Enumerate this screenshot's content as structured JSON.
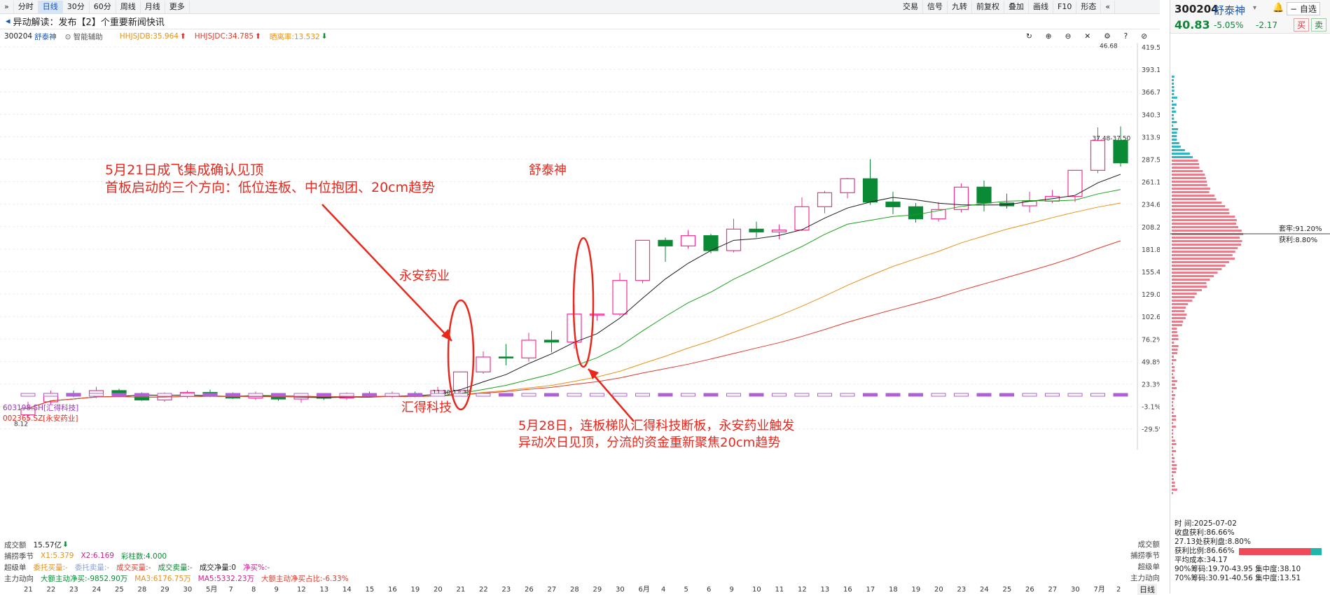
{
  "toolbar": {
    "left": [
      "分时",
      "日线",
      "30分",
      "60分",
      "周线",
      "月线",
      "更多"
    ],
    "active": "日线",
    "right": [
      "交易",
      "信号",
      "九转",
      "前复权",
      "叠加",
      "画线",
      "F10",
      "形态"
    ]
  },
  "news": {
    "prefix": "异动解读：",
    "text": "发布【2】个重要新闻快讯"
  },
  "indicators": {
    "code": "300204",
    "name": "舒泰神",
    "assist": "智能辅助",
    "hhjsjdb": "HHJSJDB:35.964",
    "hhjsjdc": "HHJSJDC:34.785",
    "rate": "晒离率:13.532"
  },
  "stock": {
    "code": "300204",
    "name": "舒泰神",
    "price": "40.83",
    "pct": "-5.05%",
    "chg": "-2.17",
    "btn_add": "自选",
    "btn_buy": "买",
    "btn_sell": "卖"
  },
  "chart_data": {
    "type": "candlestick",
    "x": [
      "21",
      "22",
      "23",
      "24",
      "25",
      "28",
      "29",
      "30",
      "5月",
      "7",
      "8",
      "9",
      "12",
      "13",
      "14",
      "15",
      "16",
      "19",
      "20",
      "21",
      "22",
      "23",
      "26",
      "27",
      "28",
      "29",
      "30",
      "6月",
      "4",
      "5",
      "6",
      "9",
      "10",
      "11",
      "12",
      "13",
      "16",
      "17",
      "18",
      "19",
      "20",
      "23",
      "24",
      "25",
      "26",
      "27",
      "30",
      "7月",
      "2"
    ],
    "y_tick_labels": [
      "419.5%",
      "393.1%",
      "366.7%",
      "340.3%",
      "313.9%",
      "287.5%",
      "261.1%",
      "234.6%",
      "208.2%",
      "181.8%",
      "155.4%",
      "129.0%",
      "102.6%",
      "76.2%",
      "49.8%",
      "23.3%",
      "-3.1%",
      "-29.5%"
    ],
    "ohlc": [
      [
        7.2,
        7.9,
        6.6,
        8.6
      ],
      [
        8.6,
        9.5,
        8.3,
        9.8
      ],
      [
        9.5,
        9.3,
        9.1,
        9.8
      ],
      [
        9.3,
        9.8,
        9.0,
        10.2
      ],
      [
        9.8,
        9.3,
        9.1,
        10.0
      ],
      [
        9.3,
        8.8,
        8.7,
        9.6
      ],
      [
        8.8,
        9.2,
        8.6,
        9.6
      ],
      [
        9.2,
        9.6,
        9.0,
        9.8
      ],
      [
        9.6,
        9.3,
        9.1,
        9.9
      ],
      [
        9.3,
        9.0,
        8.9,
        9.6
      ],
      [
        9.0,
        9.2,
        8.8,
        9.7
      ],
      [
        9.2,
        8.9,
        8.7,
        9.3
      ],
      [
        8.9,
        9.1,
        8.5,
        9.5
      ],
      [
        9.1,
        9.0,
        8.8,
        9.5
      ],
      [
        9.0,
        9.3,
        8.8,
        9.6
      ],
      [
        9.3,
        9.2,
        9.1,
        9.7
      ],
      [
        9.2,
        9.4,
        9.0,
        9.7
      ],
      [
        9.4,
        9.3,
        9.1,
        9.7
      ],
      [
        9.3,
        9.8,
        9.2,
        10.2
      ],
      [
        9.8,
        11.8,
        9.6,
        11.8
      ],
      [
        11.8,
        13.4,
        11.6,
        14.0
      ],
      [
        13.4,
        13.3,
        12.5,
        14.8
      ],
      [
        13.3,
        15.2,
        12.9,
        16.0
      ],
      [
        15.2,
        15.0,
        13.9,
        16.2
      ],
      [
        15.0,
        18.0,
        14.3,
        19.0
      ],
      [
        18.0,
        18.0,
        17.3,
        18.0
      ],
      [
        18.0,
        21.6,
        17.8,
        22.4
      ],
      [
        21.6,
        25.9,
        21.3,
        25.9
      ],
      [
        25.9,
        25.3,
        23.6,
        26.2
      ],
      [
        25.3,
        26.4,
        25.0,
        27.0
      ],
      [
        26.4,
        24.8,
        24.5,
        26.6
      ],
      [
        24.8,
        27.1,
        24.6,
        28.2
      ],
      [
        27.1,
        26.8,
        26.2,
        27.9
      ],
      [
        26.8,
        27.0,
        26.0,
        27.6
      ],
      [
        27.0,
        29.5,
        26.9,
        30.5
      ],
      [
        29.5,
        31.0,
        28.8,
        31.2
      ],
      [
        31.0,
        32.5,
        30.4,
        32.6
      ],
      [
        32.5,
        30.0,
        29.7,
        34.6
      ],
      [
        30.0,
        29.5,
        28.7,
        31.1
      ],
      [
        29.5,
        28.2,
        27.8,
        29.9
      ],
      [
        28.2,
        29.2,
        27.9,
        30.0
      ],
      [
        29.2,
        31.6,
        28.9,
        32.0
      ],
      [
        31.6,
        29.9,
        29.0,
        32.3
      ],
      [
        29.9,
        29.6,
        29.3,
        30.9
      ],
      [
        29.6,
        30.1,
        28.9,
        31.1
      ],
      [
        30.1,
        30.6,
        29.9,
        31.3
      ],
      [
        30.6,
        33.4,
        30.0,
        33.4
      ],
      [
        33.4,
        36.6,
        33.1,
        38.0
      ],
      [
        36.6,
        34.2,
        33.8,
        38.1
      ]
    ],
    "price_labels": [
      "46.68",
      "37.48-37.50",
      "8.12",
      "11.30-11.38"
    ],
    "legend_items": [
      "603198.SH[汇得科技]",
      "002365.SZ[永安药业]"
    ],
    "annotations": [
      "5月21日成飞集成确认见顶",
      "首板启动的三个方向：低位连板、中位抱团、20cm趋势",
      "舒泰神",
      "永安药业",
      "汇得科技",
      "5月28日，连板梯队汇得科技断板，永安药业触发",
      "异动次日见顶，分流的资金重新聚焦20cm趋势"
    ],
    "volume_label": "成交额",
    "volume_value": "15.57亿",
    "distribution": {
      "trapped": "套牢:91.20%",
      "profit": "获利:8.80%"
    }
  },
  "bottom": {
    "r1": {
      "label": "成交额",
      "value": "15.57亿"
    },
    "r2": {
      "label": "捕捞季节",
      "x1": "X1:5.379",
      "x2": "X2:6.169",
      "bar": "彩柱数:4.000"
    },
    "r3": {
      "label": "超级单",
      "a": "委托买量:-",
      "b": "委托卖量:-",
      "c": "成交买量:-",
      "d": "成交卖量:-",
      "e": "成交净量:0",
      "f": "净买%:-"
    },
    "r4": {
      "label": "主力动向",
      "a": "大额主动净买:-9852.90万",
      "b": "MA3:6176.75万",
      "c": "MA5:5332.23万",
      "d": "大额主动净买占比:-6.33%"
    },
    "right_labels": [
      "成交额",
      "捕捞季节",
      "超级单",
      "主力动向"
    ],
    "freq": "日线"
  },
  "panel": {
    "date": "时    间:2025-07-02",
    "rows": [
      "收盘获利:86.66%",
      "27.13处获利盘:8.80%",
      "获利比例:86.66%",
      "平均成本:34.17",
      "90%筹码:19.70-43.95",
      "70%筹码:30.91-40.56"
    ],
    "conc1": "集中度:38.10",
    "conc2": "集中度:13.51"
  },
  "colors": {
    "up": "#f5318f",
    "down": "#0a8a35",
    "ma5": "#1a1a1a",
    "ma10": "#1aa11a",
    "ma20": "#e8911a",
    "ma30": "#e23a2a",
    "ann": "#e8271d"
  }
}
